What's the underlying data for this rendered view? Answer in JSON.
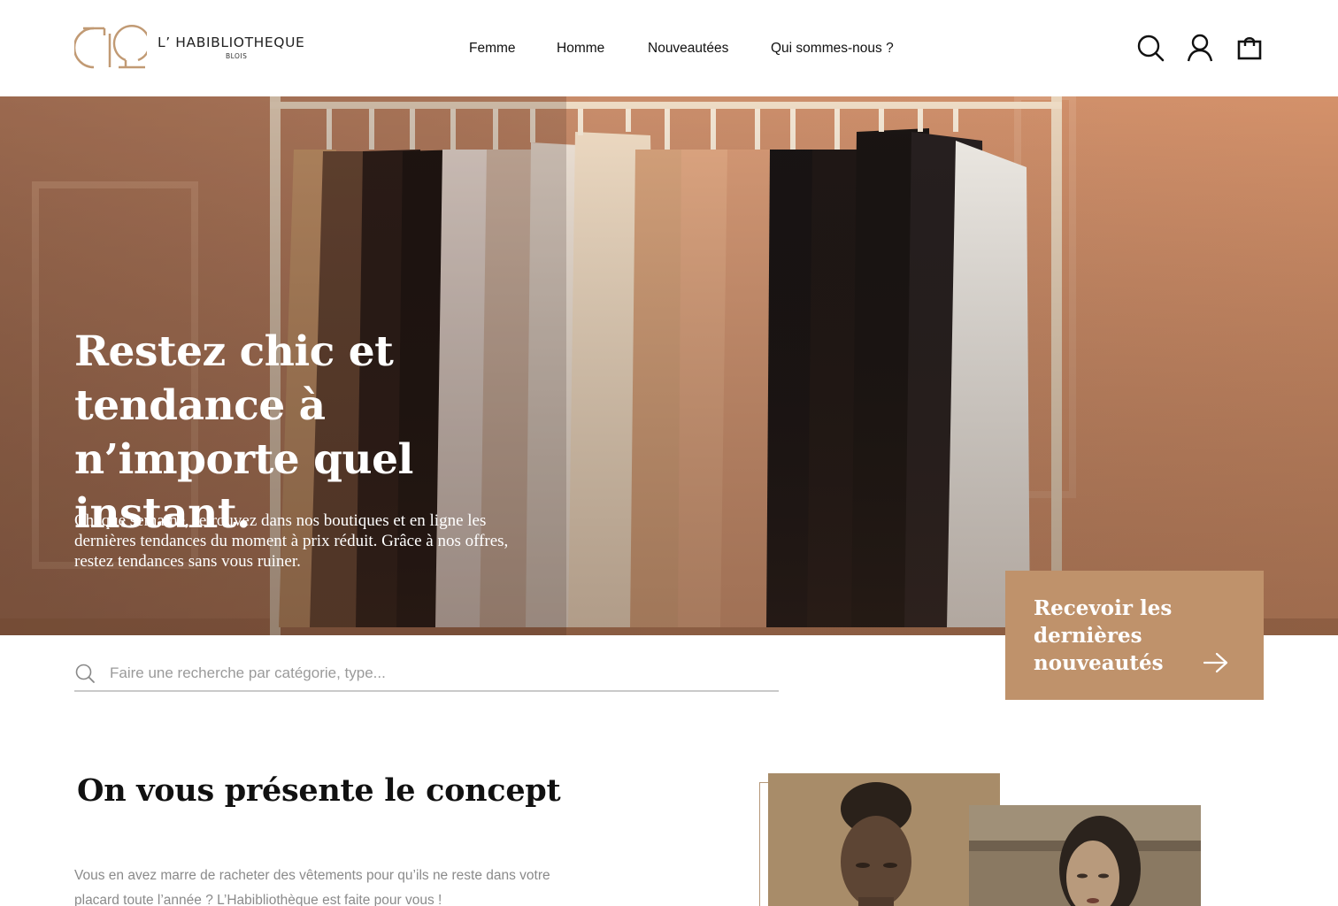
{
  "header": {
    "logo": {
      "name": "L’ HABIBLIOTHEQUE",
      "city": "BLOIS"
    },
    "nav": [
      "Femme",
      "Homme",
      "Nouveautées",
      "Qui sommes-nous ?"
    ],
    "icons": [
      "search-icon",
      "account-icon",
      "shopping-bag-icon"
    ]
  },
  "hero": {
    "title": "Restez chic et tendance à n’importe quel instant.",
    "text": "Chaque semaine, retrouvez dans nos boutiques et en ligne les dernières tendances du moment à prix réduit. Grâce à nos offres, restez tendances sans vous ruiner.",
    "newsletter_label": "Recevoir les dernières nouveautés"
  },
  "search": {
    "placeholder": "Faire une recherche par catégorie, type...",
    "value": ""
  },
  "concept": {
    "title": "On vous présente le concept",
    "text": "Vous en avez marre de racheter des vêtements pour qu’ils ne reste dans votre placard toute l’année ? L’Habibliothèque est faite pour vous !"
  },
  "colors": {
    "brand": "#bf926b",
    "logo": "#c19a74",
    "hero_wall": "#c98a66"
  }
}
